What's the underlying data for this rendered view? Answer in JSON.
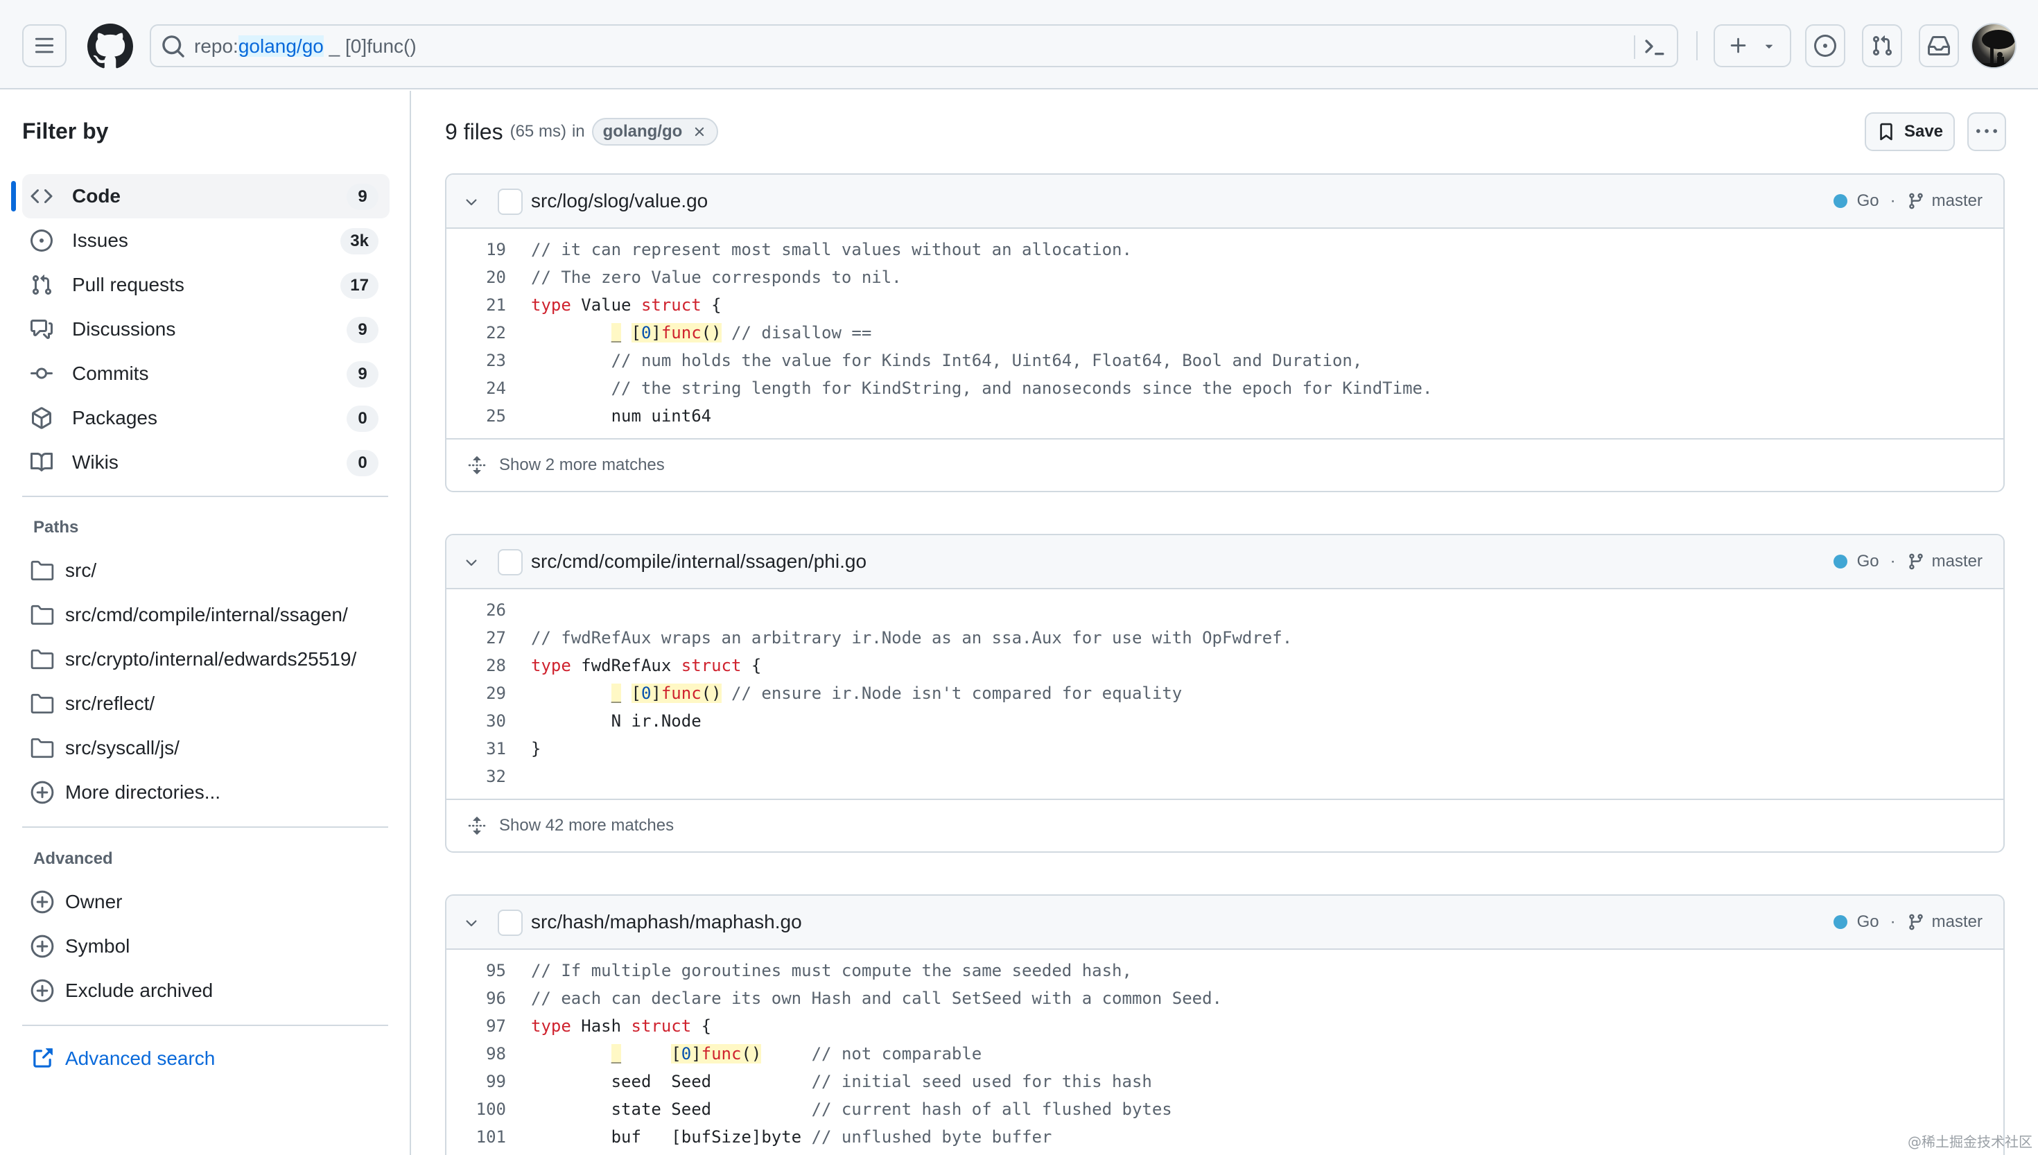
{
  "header": {
    "search_query_qualifier_prefix": "repo:",
    "search_query_qualifier_value": "golang/go",
    "search_query_rest": " _ [0]func()",
    "icons": {
      "menu": "hamburger-icon",
      "logo": "github-logo-icon",
      "search": "search-icon",
      "command_palette": "terminal-icon",
      "create": "plus-icon",
      "create_dropdown": "triangle-down-icon",
      "issues": "issue-opened-icon",
      "pull_requests": "git-pull-request-icon",
      "inbox": "inbox-icon",
      "avatar": "user-avatar"
    }
  },
  "sidebar": {
    "title": "Filter by",
    "types": [
      {
        "label": "Code",
        "count": "9",
        "icon": "code-icon",
        "active": true
      },
      {
        "label": "Issues",
        "count": "3k",
        "icon": "issue-opened-icon",
        "active": false
      },
      {
        "label": "Pull requests",
        "count": "17",
        "icon": "git-pull-request-icon",
        "active": false
      },
      {
        "label": "Discussions",
        "count": "9",
        "icon": "comment-discussion-icon",
        "active": false
      },
      {
        "label": "Commits",
        "count": "9",
        "icon": "git-commit-icon",
        "active": false
      },
      {
        "label": "Packages",
        "count": "0",
        "icon": "package-icon",
        "active": false
      },
      {
        "label": "Wikis",
        "count": "0",
        "icon": "book-icon",
        "active": false
      }
    ],
    "paths_heading": "Paths",
    "paths": [
      {
        "label": "src/"
      },
      {
        "label": "src/cmd/compile/internal/ssagen/"
      },
      {
        "label": "src/crypto/internal/edwards25519/"
      },
      {
        "label": "src/reflect/"
      },
      {
        "label": "src/syscall/js/"
      }
    ],
    "more_directories": "More directories...",
    "advanced_heading": "Advanced",
    "advanced": [
      {
        "label": "Owner"
      },
      {
        "label": "Symbol"
      },
      {
        "label": "Exclude archived"
      }
    ],
    "advanced_search": "Advanced search"
  },
  "results": {
    "count_label": "9 files",
    "time_label": "(65 ms)",
    "in_label": "in",
    "repo_chip": "golang/go",
    "save_label": "Save",
    "files": [
      {
        "path": "src/log/slog/value.go",
        "language": "Go",
        "language_color": "#41a6d4",
        "branch": "master",
        "lines": [
          {
            "no": "19",
            "segments": [
              {
                "t": "// it can represent most small values without an allocation.",
                "c": "comment"
              }
            ]
          },
          {
            "no": "20",
            "segments": [
              {
                "t": "// The zero Value corresponds to nil.",
                "c": "comment"
              }
            ]
          },
          {
            "no": "21",
            "segments": [
              {
                "t": "type",
                "c": "kw"
              },
              {
                "t": " Value ",
                "c": ""
              },
              {
                "t": "struct",
                "c": "kw"
              },
              {
                "t": " {",
                "c": ""
              }
            ]
          },
          {
            "no": "22",
            "segments": [
              {
                "t": "        ",
                "c": ""
              },
              {
                "t": "_",
                "c": "hl"
              },
              {
                "t": " ",
                "c": ""
              },
              {
                "t": "[",
                "c": "hl"
              },
              {
                "t": "0",
                "c": "hl num"
              },
              {
                "t": "]",
                "c": "hl"
              },
              {
                "t": "func",
                "c": "hl kw"
              },
              {
                "t": "()",
                "c": "hl"
              },
              {
                "t": " ",
                "c": ""
              },
              {
                "t": "// disallow ==",
                "c": "comment"
              }
            ]
          },
          {
            "no": "23",
            "segments": [
              {
                "t": "        ",
                "c": ""
              },
              {
                "t": "// num holds the value for Kinds Int64, Uint64, Float64, Bool and Duration,",
                "c": "comment"
              }
            ]
          },
          {
            "no": "24",
            "segments": [
              {
                "t": "        ",
                "c": ""
              },
              {
                "t": "// the string length for KindString, and nanoseconds since the epoch for KindTime.",
                "c": "comment"
              }
            ]
          },
          {
            "no": "25",
            "segments": [
              {
                "t": "        num uint64",
                "c": ""
              }
            ]
          }
        ],
        "show_more": "Show 2 more matches"
      },
      {
        "path": "src/cmd/compile/internal/ssagen/phi.go",
        "language": "Go",
        "language_color": "#41a6d4",
        "branch": "master",
        "lines": [
          {
            "no": "26",
            "segments": [
              {
                "t": "",
                "c": ""
              }
            ]
          },
          {
            "no": "27",
            "segments": [
              {
                "t": "// fwdRefAux wraps an arbitrary ir.Node as an ssa.Aux for use with OpFwdref.",
                "c": "comment"
              }
            ]
          },
          {
            "no": "28",
            "segments": [
              {
                "t": "type",
                "c": "kw"
              },
              {
                "t": " fwdRefAux ",
                "c": ""
              },
              {
                "t": "struct",
                "c": "kw"
              },
              {
                "t": " {",
                "c": ""
              }
            ]
          },
          {
            "no": "29",
            "segments": [
              {
                "t": "        ",
                "c": ""
              },
              {
                "t": "_",
                "c": "hl"
              },
              {
                "t": " ",
                "c": ""
              },
              {
                "t": "[",
                "c": "hl"
              },
              {
                "t": "0",
                "c": "hl num"
              },
              {
                "t": "]",
                "c": "hl"
              },
              {
                "t": "func",
                "c": "hl kw"
              },
              {
                "t": "()",
                "c": "hl"
              },
              {
                "t": " ",
                "c": ""
              },
              {
                "t": "// ensure ir.Node isn't compared for equality",
                "c": "comment"
              }
            ]
          },
          {
            "no": "30",
            "segments": [
              {
                "t": "        N ir.Node",
                "c": ""
              }
            ]
          },
          {
            "no": "31",
            "segments": [
              {
                "t": "}",
                "c": ""
              }
            ]
          },
          {
            "no": "32",
            "segments": [
              {
                "t": "",
                "c": ""
              }
            ]
          }
        ],
        "show_more": "Show 42 more matches"
      },
      {
        "path": "src/hash/maphash/maphash.go",
        "language": "Go",
        "language_color": "#41a6d4",
        "branch": "master",
        "lines": [
          {
            "no": "95",
            "segments": [
              {
                "t": "// If multiple goroutines must compute the same seeded hash,",
                "c": "comment"
              }
            ]
          },
          {
            "no": "96",
            "segments": [
              {
                "t": "// each can declare its own Hash and call SetSeed with a common Seed.",
                "c": "comment"
              }
            ]
          },
          {
            "no": "97",
            "segments": [
              {
                "t": "type",
                "c": "kw"
              },
              {
                "t": " Hash ",
                "c": ""
              },
              {
                "t": "struct",
                "c": "kw"
              },
              {
                "t": " {",
                "c": ""
              }
            ]
          },
          {
            "no": "98",
            "segments": [
              {
                "t": "        ",
                "c": ""
              },
              {
                "t": "_",
                "c": "hl"
              },
              {
                "t": "     ",
                "c": ""
              },
              {
                "t": "[",
                "c": "hl"
              },
              {
                "t": "0",
                "c": "hl num"
              },
              {
                "t": "]",
                "c": "hl"
              },
              {
                "t": "func",
                "c": "hl kw"
              },
              {
                "t": "()",
                "c": "hl"
              },
              {
                "t": "     ",
                "c": ""
              },
              {
                "t": "// not comparable",
                "c": "comment"
              }
            ]
          },
          {
            "no": "99",
            "segments": [
              {
                "t": "        seed  Seed          ",
                "c": ""
              },
              {
                "t": "// initial seed used for this hash",
                "c": "comment"
              }
            ]
          },
          {
            "no": "100",
            "segments": [
              {
                "t": "        state Seed          ",
                "c": ""
              },
              {
                "t": "// current hash of all flushed bytes",
                "c": "comment"
              }
            ]
          },
          {
            "no": "101",
            "segments": [
              {
                "t": "        buf   [bufSize]byte ",
                "c": ""
              },
              {
                "t": "// unflushed byte buffer",
                "c": "comment"
              }
            ]
          }
        ],
        "show_more": ""
      }
    ]
  },
  "watermark": "@稀土掘金技术社区"
}
